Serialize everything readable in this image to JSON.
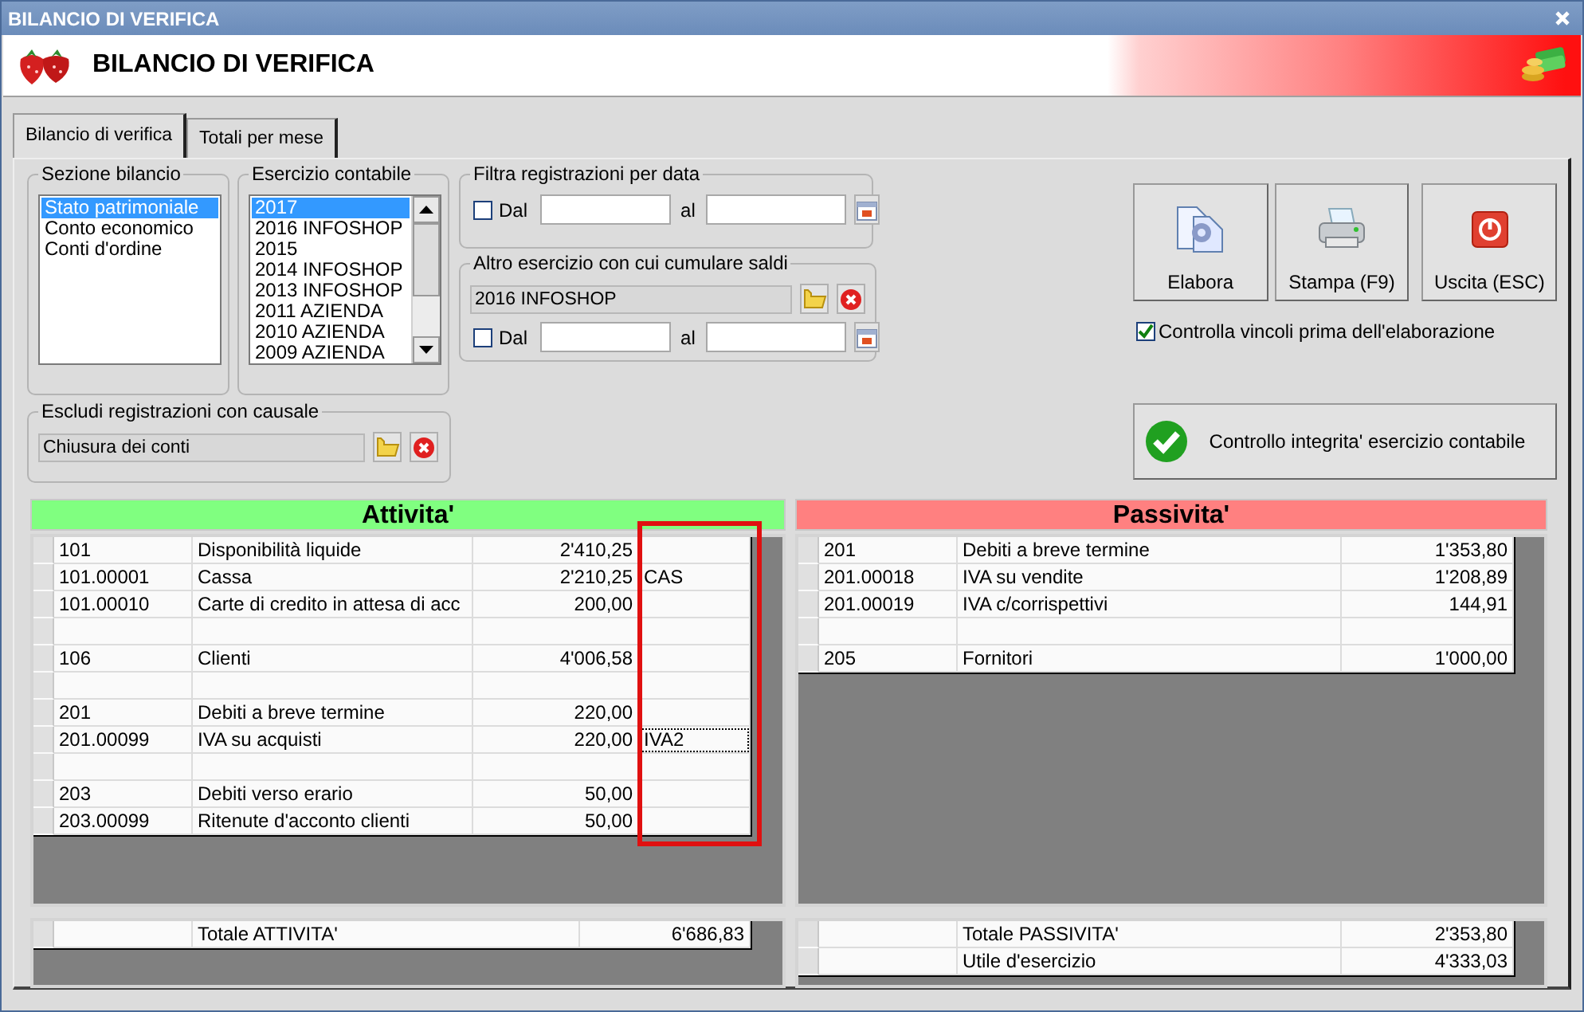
{
  "window": {
    "title": "BILANCIO DI VERIFICA"
  },
  "banner": {
    "title": "BILANCIO DI VERIFICA"
  },
  "tabs": [
    {
      "label": "Bilancio di verifica",
      "selected": true
    },
    {
      "label": "Totali per mese",
      "selected": false
    }
  ],
  "sezione_bilancio": {
    "title": "Sezione bilancio",
    "items": [
      {
        "label": "Stato patrimoniale",
        "selected": true
      },
      {
        "label": "Conto economico",
        "selected": false
      },
      {
        "label": "Conti d'ordine",
        "selected": false
      }
    ]
  },
  "esercizio_contabile": {
    "title": "Esercizio contabile",
    "items": [
      {
        "label": "2017",
        "selected": true
      },
      {
        "label": "2016 INFOSHOP",
        "selected": false
      },
      {
        "label": "2015",
        "selected": false
      },
      {
        "label": "2014 INFOSHOP",
        "selected": false
      },
      {
        "label": "2013 INFOSHOP",
        "selected": false
      },
      {
        "label": "2011 AZIENDA",
        "selected": false
      },
      {
        "label": "2010 AZIENDA",
        "selected": false
      },
      {
        "label": "2009 AZIENDA",
        "selected": false
      }
    ]
  },
  "filtra_per_data": {
    "title": "Filtra registrazioni per data",
    "dal": {
      "label": "Dal",
      "checked": false
    },
    "al_label": "al"
  },
  "altro_esercizio": {
    "title": "Altro esercizio con cui cumulare saldi",
    "value": "2016 INFOSHOP",
    "dal": {
      "label": "Dal",
      "checked": false
    },
    "al_label": "al"
  },
  "escludi_causale": {
    "title": "Escludi registrazioni con causale",
    "value": "Chiusura dei conti"
  },
  "buttons": [
    {
      "kind": "process",
      "label": "Elabora"
    },
    {
      "kind": "print",
      "label": "Stampa (F9)"
    },
    {
      "kind": "exit",
      "label": "Uscita (ESC)"
    }
  ],
  "controlla_vincoli": {
    "label": "Controlla vincoli prima dell'elaborazione",
    "checked": true
  },
  "integrity_button": {
    "label": "Controllo integrita' esercizio contabile"
  },
  "attivita": {
    "title": "Attivita'",
    "rows": [
      {
        "code": "101",
        "description": "Disponibilità liquide",
        "amount": "2'410,25",
        "focused": false
      },
      {
        "code": "101.00001",
        "description": "Cassa",
        "amount": "2'210,25",
        "column_5": "CAS",
        "focused": false
      },
      {
        "code": "101.00010",
        "description": "Carte di credito in attesa di acc",
        "amount": "200,00",
        "focused": false
      },
      {
        "focused": false
      },
      {
        "code": "106",
        "description": "Clienti",
        "amount": "4'006,58",
        "focused": false
      },
      {
        "focused": false
      },
      {
        "code": "201",
        "description": "Debiti a breve termine",
        "amount": "220,00",
        "focused": false
      },
      {
        "code": "201.00099",
        "description": "IVA su acquisti",
        "amount": "220,00",
        "column_5": "IVA2",
        "focused": true
      },
      {
        "focused": false
      },
      {
        "code": "203",
        "description": "Debiti verso erario",
        "amount": "50,00",
        "focused": false
      },
      {
        "code": "203.00099",
        "description": "Ritenute d'acconto clienti",
        "amount": "50,00",
        "focused": false
      }
    ],
    "totals": [
      {
        "label": "Totale ATTIVITA'",
        "amount": "6'686,83"
      }
    ]
  },
  "passivita": {
    "title": "Passivita'",
    "rows": [
      {
        "code": "201",
        "description": "Debiti a breve termine",
        "amount": "1'353,80"
      },
      {
        "code": "201.00018",
        "description": "IVA su vendite",
        "amount": "1'208,89"
      },
      {
        "code": "201.00019",
        "description": "IVA c/corrispettivi",
        "amount": "144,91"
      },
      {},
      {
        "code": "205",
        "description": "Fornitori",
        "amount": "1'000,00"
      }
    ],
    "totals": [
      {
        "label": "Totale PASSIVITA'",
        "amount": "2'353,80"
      },
      {
        "label": "Utile d'esercizio",
        "amount": "4'333,03"
      }
    ]
  }
}
